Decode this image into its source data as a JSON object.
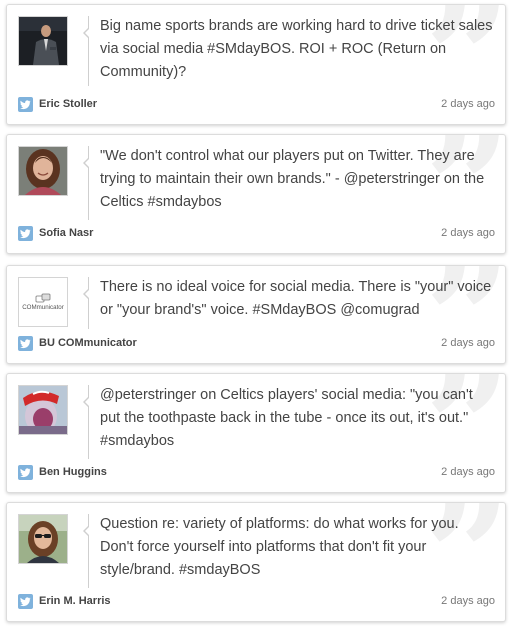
{
  "colors": {
    "text": "#444444",
    "time": "#777777",
    "twitter_icon_bg": "#7fb2dc",
    "card_border": "#dcdcdc",
    "quote_watermark": "#f0f0f0"
  },
  "decor": {
    "quote_glyph": "”",
    "quote_icon": "quote-watermark-icon",
    "platform_icon": "twitter-bird-icon"
  },
  "tweets": [
    {
      "text": "Big name sports brands are working hard to drive ticket sales via social media #SMdayBOS. ROI + ROC (Return on Community)?",
      "author": "Eric Stoller",
      "time": "2 days ago",
      "avatar": "man-in-dark-jacket-photo"
    },
    {
      "text": "\"We don't control what our players put on Twitter. They are trying to maintain their own brands.\" - @peterstringer on the Celtics #smdaybos",
      "author": "Sofia Nasr",
      "time": "2 days ago",
      "avatar": "woman-with-curly-hair-photo"
    },
    {
      "text": "There is no ideal voice for social media. There is \"your\" voice or \"your brand's\" voice. #SMdayBOS @comugrad",
      "author": "BU COMmunicator",
      "time": "2 days ago",
      "avatar": "communicator-logo",
      "avatar_logo_text": "COMmunicator"
    },
    {
      "text": "@peterstringer on Celtics players' social media: \"you can't put the toothpaste back in the tube - once its out, it's out.\" #smdaybos",
      "author": "Ben Huggins",
      "time": "2 days ago",
      "avatar": "person-in-red-cap-photo"
    },
    {
      "text": "Question re: variety of platforms: do what works for you. Don't force yourself into platforms that don't fit your style/brand. #smdayBOS",
      "author": "Erin M. Harris",
      "time": "2 days ago",
      "avatar": "woman-with-sunglasses-photo"
    }
  ]
}
